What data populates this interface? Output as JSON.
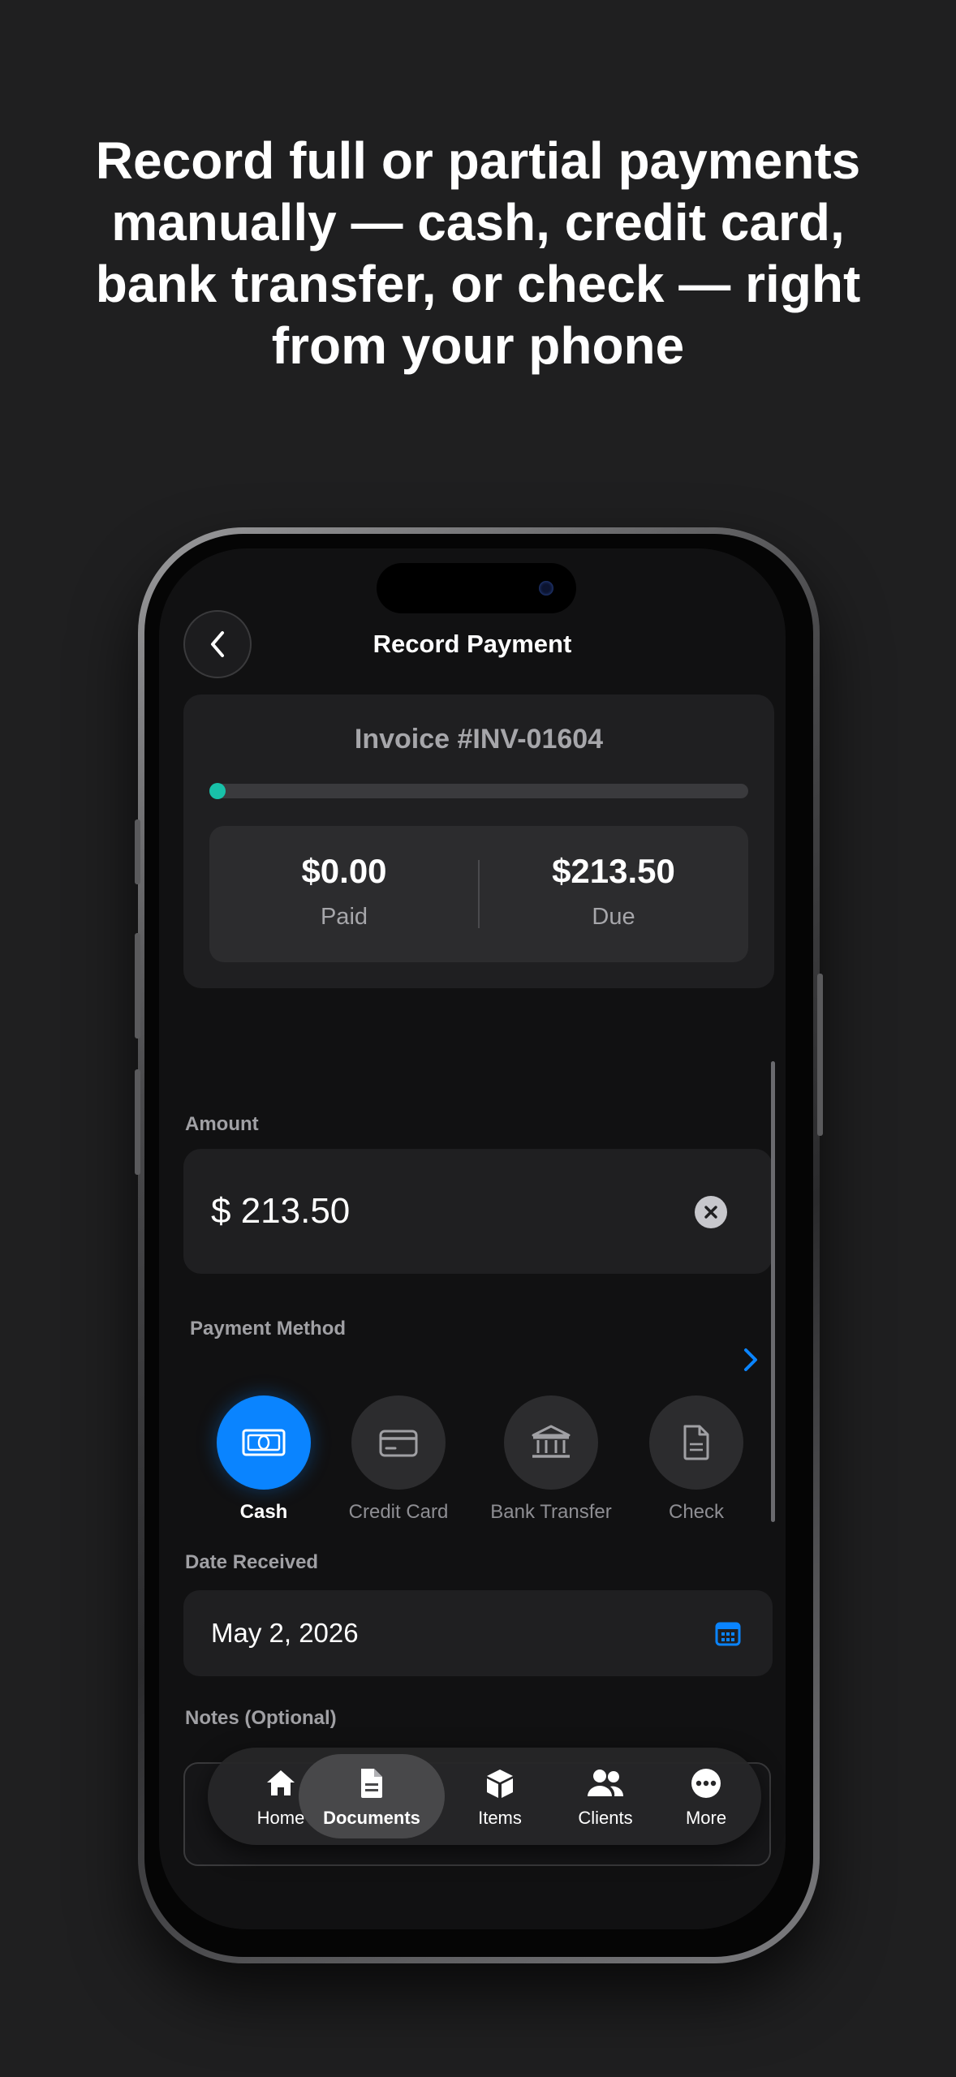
{
  "headline": "Record full or partial payments manually — cash, credit card, bank transfer, or check — right from your phone",
  "screen": {
    "title": "Record Payment",
    "invoice": {
      "number": "Invoice #INV-01604",
      "progress_fraction": 0.0,
      "paid_value": "$0.00",
      "paid_label": "Paid",
      "due_value": "$213.50",
      "due_label": "Due"
    },
    "amount": {
      "label": "Amount",
      "value": "$ 213.50"
    },
    "payment_method": {
      "label": "Payment Method",
      "options": [
        {
          "label": "Cash",
          "icon": "cash-icon",
          "selected": true
        },
        {
          "label": "Credit Card",
          "icon": "credit-card-icon",
          "selected": false
        },
        {
          "label": "Bank Transfer",
          "icon": "bank-icon",
          "selected": false
        },
        {
          "label": "Check",
          "icon": "document-icon",
          "selected": false
        }
      ]
    },
    "date": {
      "label": "Date Received",
      "value": "May 2, 2026"
    },
    "notes": {
      "label": "Notes (Optional)"
    }
  },
  "tabbar": {
    "tabs": [
      {
        "label": "Home",
        "icon": "home-icon",
        "active": false
      },
      {
        "label": "Documents",
        "icon": "documents-icon",
        "active": true
      },
      {
        "label": "Items",
        "icon": "box-icon",
        "active": false
      },
      {
        "label": "Clients",
        "icon": "people-icon",
        "active": false
      },
      {
        "label": "More",
        "icon": "more-icon",
        "active": false
      }
    ]
  },
  "colors": {
    "background": "#1f1f20",
    "accent": "#0a84ff",
    "progress_start": "#16c7a8"
  }
}
